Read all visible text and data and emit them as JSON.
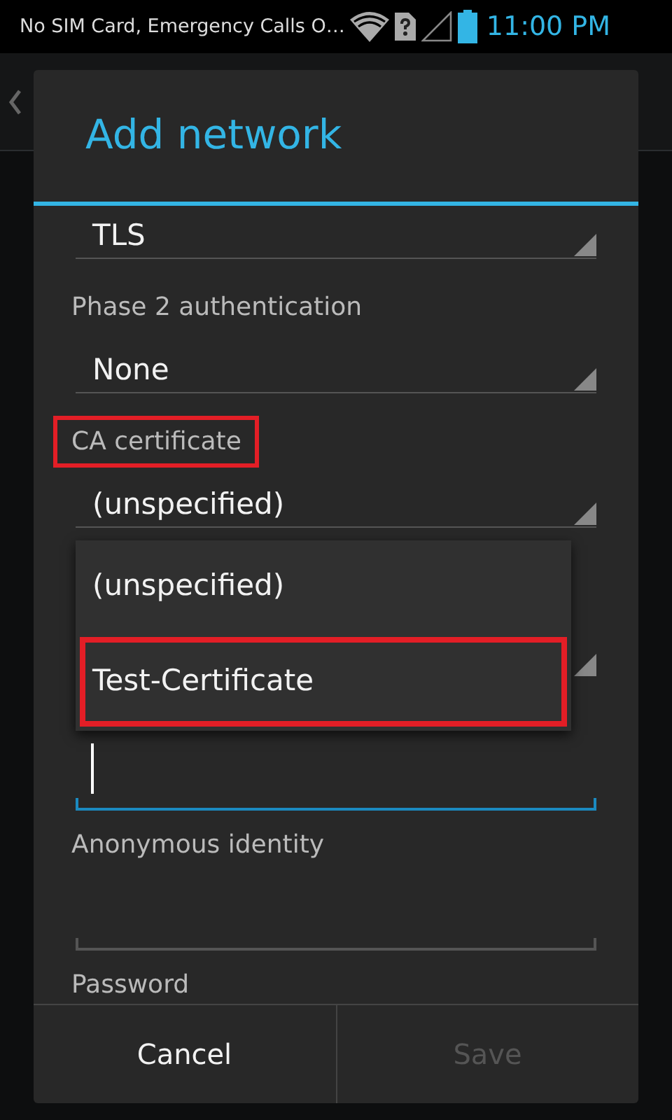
{
  "status_bar": {
    "notification": "No SIM Card, Emergency Calls O…",
    "time": "11:00 PM"
  },
  "dialog": {
    "title": "Add network",
    "rows": [
      {
        "kind": "spinner",
        "value": "TLS"
      },
      {
        "kind": "label",
        "text": "Phase 2 authentication",
        "highlighted": false
      },
      {
        "kind": "spinner",
        "value": "None"
      },
      {
        "kind": "label",
        "text": "CA certificate",
        "highlighted": true
      },
      {
        "kind": "spinner",
        "value": "(unspecified)"
      },
      {
        "kind": "covered"
      },
      {
        "kind": "spinner_covered"
      },
      {
        "kind": "covered"
      },
      {
        "kind": "input",
        "focused": true
      },
      {
        "kind": "label",
        "text": "Anonymous identity",
        "highlighted": false
      },
      {
        "kind": "input",
        "focused": false
      },
      {
        "kind": "label",
        "text": "Password",
        "highlighted": false
      }
    ],
    "buttons": [
      {
        "label": "Cancel",
        "disabled": false
      },
      {
        "label": "Save",
        "disabled": true
      }
    ]
  },
  "dropdown": {
    "items": [
      {
        "label": "(unspecified)",
        "highlighted": false
      },
      {
        "label": "Test-Certificate",
        "highlighted": true
      }
    ]
  }
}
